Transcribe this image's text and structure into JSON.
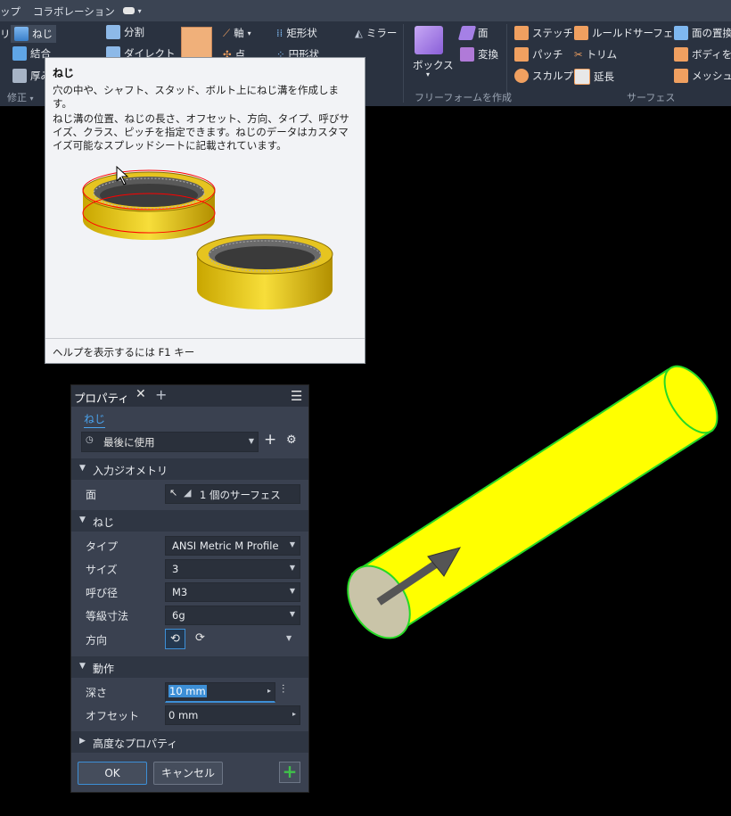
{
  "tabs": [
    "ップ",
    "コラボレーション"
  ],
  "ribbon": {
    "modify": {
      "thread": "ねじ",
      "combine": "結合",
      "thicken": "厚み",
      "split": "分割",
      "direct": "ダイレクト",
      "group_label": "修正"
    },
    "work": {
      "axis": "軸",
      "point": "点",
      "rect_pattern": "矩形状",
      "circ_pattern": "円形状",
      "mirror": "ミラー"
    },
    "freeform": {
      "box": "ボックス",
      "face": "面",
      "convert": "変換",
      "group_label": "フリーフォームを作成"
    },
    "surface": {
      "stitch": "ステッチ",
      "patch": "パッチ",
      "sculpt": "スカルプ",
      "ruled": "ルールドサーフェス",
      "trim": "トリム",
      "extend": "延長",
      "replace_face": "面の置換",
      "repair": "ボディを修",
      "mesh": "メッシュの",
      "group_label": "サーフェス"
    }
  },
  "tooltip": {
    "title": "ねじ",
    "desc1": "穴の中や、シャフト、スタッド、ボルト上にねじ溝を作成します。",
    "desc2": "ねじ溝の位置、ねじの長さ、オフセット、方向、タイプ、呼びサイズ、クラス、ピッチを指定できます。ねじのデータはカスタマイズ可能なスプレッドシートに記載されています。",
    "footer": "ヘルプを表示するには F1 キー"
  },
  "panel": {
    "tab_label": "プロパティ",
    "feature_name": "ねじ",
    "preset": "最後に使用",
    "sections": {
      "input": "入力ジオメトリ",
      "thread": "ねじ",
      "behavior": "動作",
      "advanced": "高度なプロパティ"
    },
    "face": {
      "label": "面",
      "value": "1 個のサーフェス"
    },
    "type": {
      "label": "タイプ",
      "value": "ANSI Metric M Profile"
    },
    "size": {
      "label": "サイズ",
      "value": "3"
    },
    "designation": {
      "label": "呼び径",
      "value": "M3"
    },
    "class": {
      "label": "等級寸法",
      "value": "6g"
    },
    "direction": {
      "label": "方向"
    },
    "depth": {
      "label": "深さ",
      "value": "10 mm"
    },
    "offset": {
      "label": "オフセット",
      "value": "0 mm"
    },
    "ok": "OK",
    "cancel": "キャンセル"
  },
  "colors": {
    "cylinder": "#ffff00",
    "edge_highlight": "#26d926",
    "accent": "#3d8fd6"
  }
}
